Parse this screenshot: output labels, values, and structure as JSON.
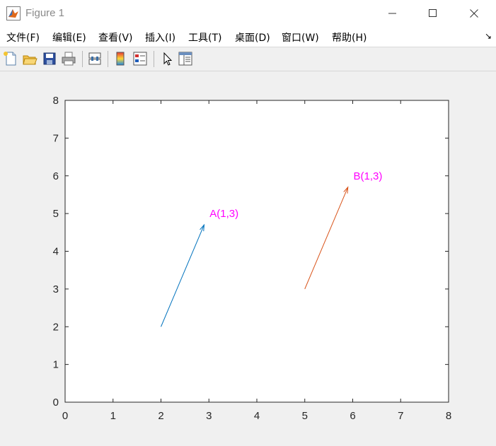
{
  "window": {
    "title": "Figure 1",
    "icons": {
      "app": "matlab-icon",
      "minimize": "minimize-icon",
      "maximize": "maximize-icon",
      "close": "close-icon"
    }
  },
  "menu": {
    "items": [
      {
        "label": "文件(F)"
      },
      {
        "label": "编辑(E)"
      },
      {
        "label": "查看(V)"
      },
      {
        "label": "插入(I)"
      },
      {
        "label": "工具(T)"
      },
      {
        "label": "桌面(D)"
      },
      {
        "label": "窗口(W)"
      },
      {
        "label": "帮助(H)"
      }
    ],
    "dock_arrow": "↘"
  },
  "toolbar": {
    "buttons": [
      "new-figure-icon",
      "open-file-icon",
      "save-icon",
      "print-icon",
      "link-plot-icon",
      "colorbar-icon",
      "legend-icon",
      "pointer-icon",
      "property-inspector-icon"
    ]
  },
  "chart_data": {
    "type": "quiver",
    "xlim": [
      0,
      8
    ],
    "ylim": [
      0,
      8
    ],
    "xticks": [
      0,
      1,
      2,
      3,
      4,
      5,
      6,
      7,
      8
    ],
    "yticks": [
      0,
      1,
      2,
      3,
      4,
      5,
      6,
      7,
      8
    ],
    "grid": false,
    "arrows": [
      {
        "x": 2,
        "y": 2,
        "u": 0.9,
        "v": 2.7,
        "color": "#0072BD"
      },
      {
        "x": 5,
        "y": 3,
        "u": 0.9,
        "v": 2.7,
        "color": "#D95319"
      }
    ],
    "annotations": [
      {
        "text": "A(1,3)",
        "x": 3,
        "y": 5,
        "color": "#FF00FF"
      },
      {
        "text": "B(1,3)",
        "x": 6,
        "y": 6,
        "color": "#FF00FF"
      }
    ]
  }
}
